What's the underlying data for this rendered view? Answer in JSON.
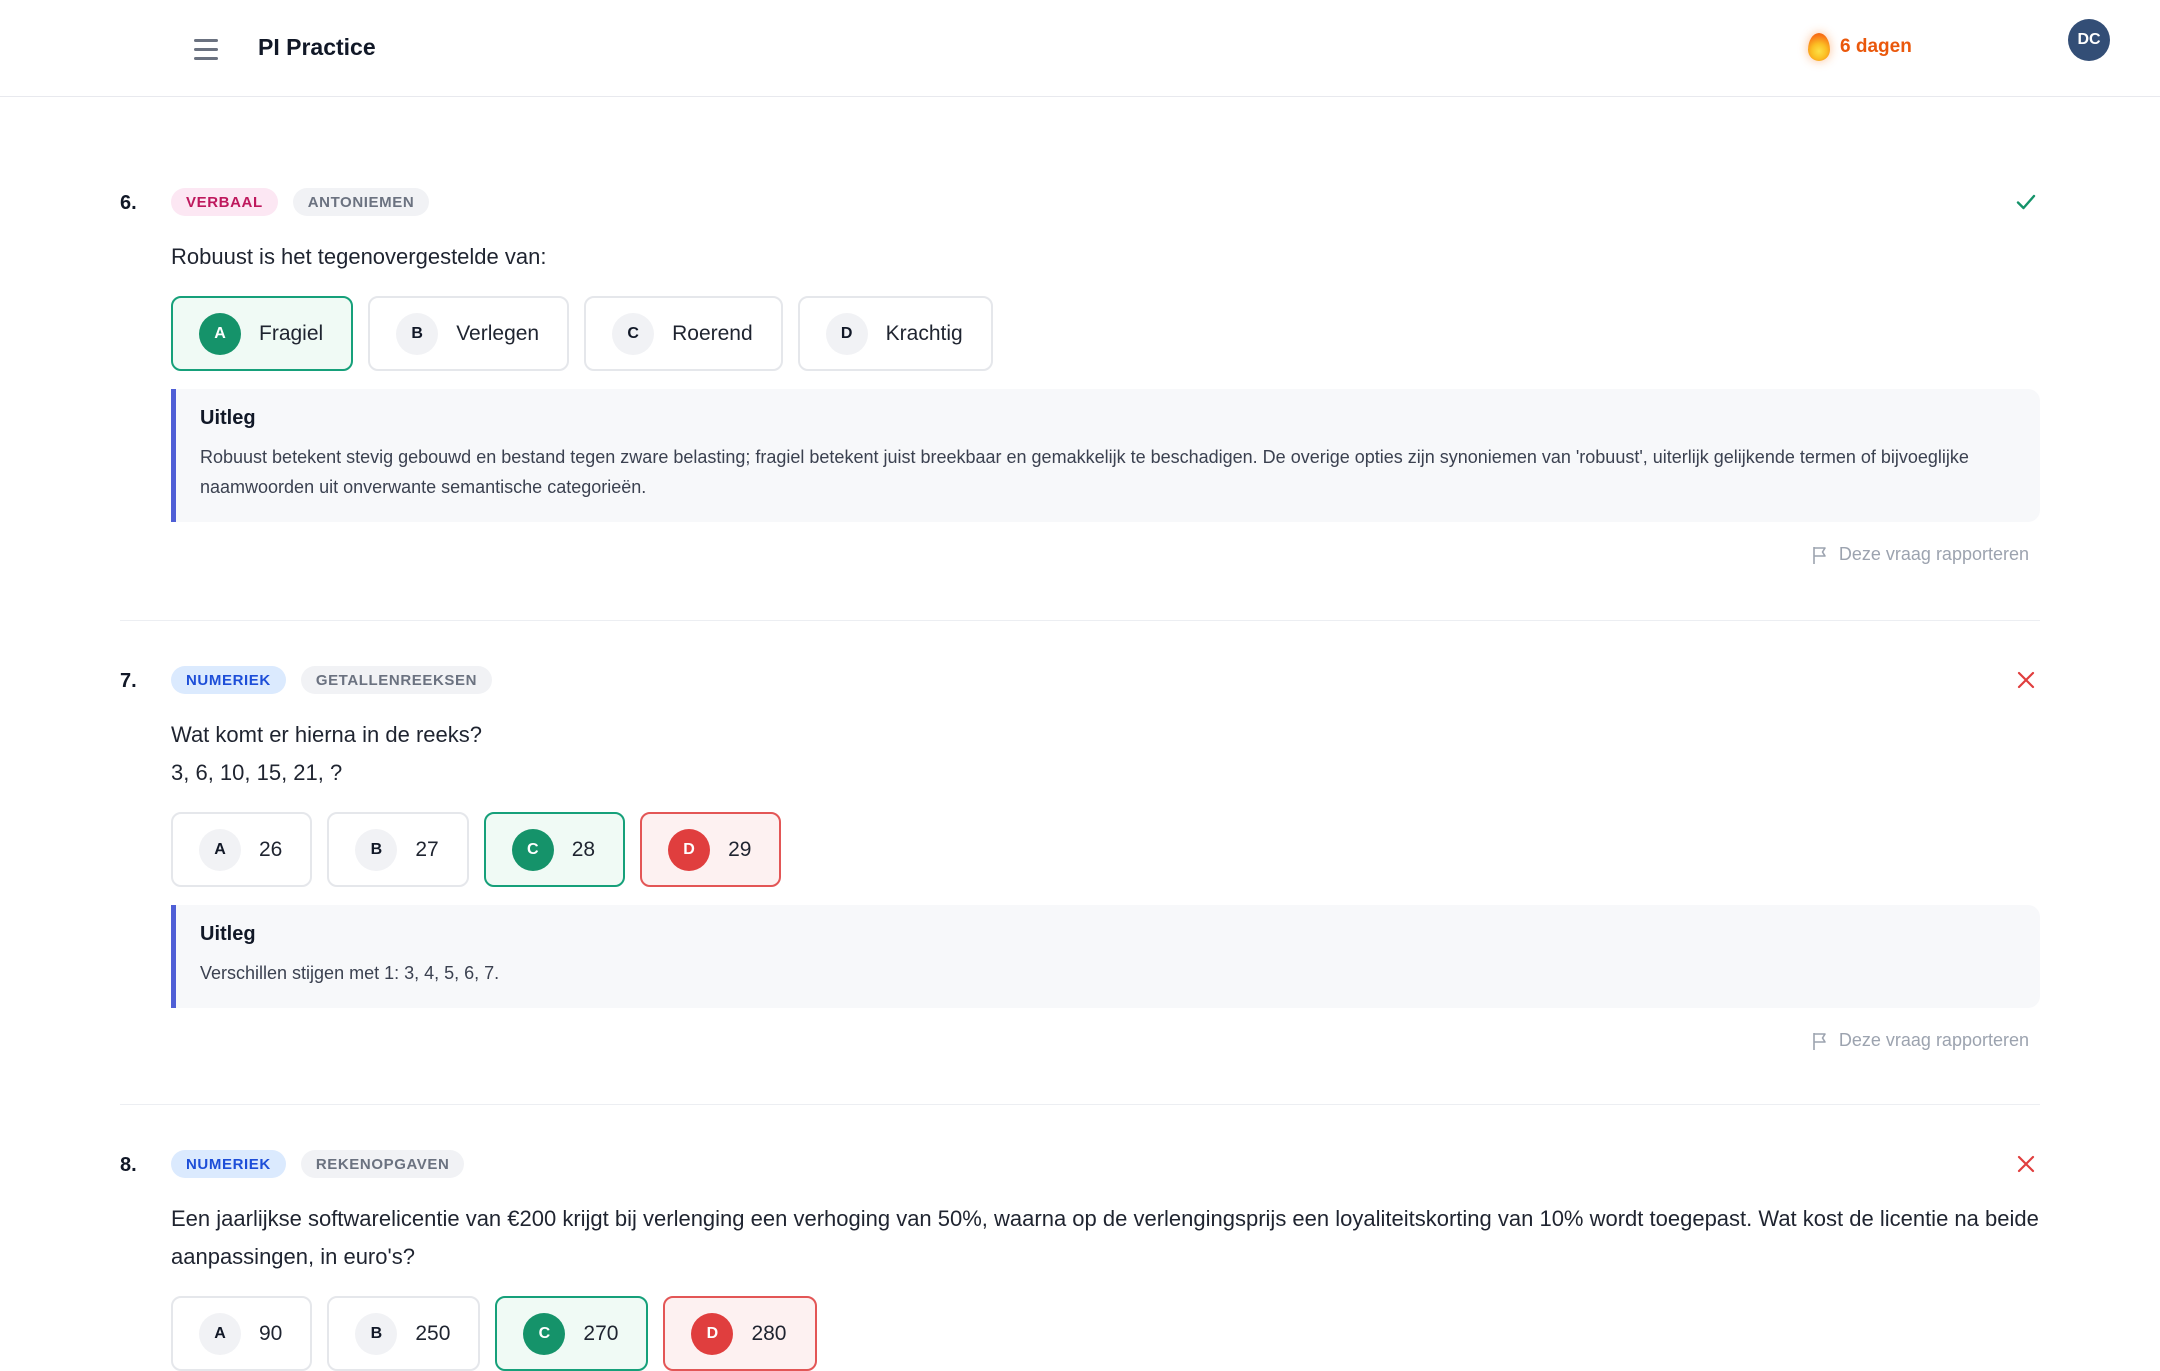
{
  "app": {
    "title": "PI Practice",
    "streak_text": "6 dagen",
    "avatar_initials": "DC"
  },
  "labels": {
    "explanation_title": "Uitleg",
    "report": "Deze vraag rapporteren"
  },
  "colors": {
    "correct": "#15936a",
    "wrong": "#e03e3e",
    "accent_bar": "#4f5fd6",
    "streak": "#ea580c"
  },
  "questions": [
    {
      "number": "6.",
      "category": "VERBAAL",
      "subcategory": "ANTONIEMEN",
      "status": "correct",
      "status_icon": "check-icon",
      "text": "Robuust is het tegenovergestelde van:",
      "options": [
        {
          "letter": "A",
          "value": "Fragiel",
          "state": "correct"
        },
        {
          "letter": "B",
          "value": "Verlegen",
          "state": "neutral"
        },
        {
          "letter": "C",
          "value": "Roerend",
          "state": "neutral"
        },
        {
          "letter": "D",
          "value": "Krachtig",
          "state": "neutral"
        }
      ],
      "explanation": "Robuust betekent stevig gebouwd en bestand tegen zware belasting; fragiel betekent juist breekbaar en gemakkelijk te beschadigen. De overige opties zijn synoniemen van 'robuust', uiterlijk gelijkende termen of bijvoeglijke naamwoorden uit onverwante semantische categorieën."
    },
    {
      "number": "7.",
      "category": "NUMERIEK",
      "subcategory": "GETALLENREEKSEN",
      "status": "wrong",
      "status_icon": "cross-icon",
      "text": "Wat komt er hierna in de reeks?",
      "text_line2": "3, 6, 10, 15, 21, ?",
      "options": [
        {
          "letter": "A",
          "value": "26",
          "state": "neutral"
        },
        {
          "letter": "B",
          "value": "27",
          "state": "neutral"
        },
        {
          "letter": "C",
          "value": "28",
          "state": "correct"
        },
        {
          "letter": "D",
          "value": "29",
          "state": "wrong"
        }
      ],
      "explanation": "Verschillen stijgen met 1: 3, 4, 5, 6, 7."
    },
    {
      "number": "8.",
      "category": "NUMERIEK",
      "subcategory": "REKENOPGAVEN",
      "status": "wrong",
      "status_icon": "cross-icon",
      "text": "Een jaarlijkse softwarelicentie van €200 krijgt bij verlenging een verhoging van 50%, waarna op de verlengingsprijs een loyaliteitskorting van 10% wordt toegepast. Wat kost de licentie na beide aanpassingen, in euro's?",
      "options": [
        {
          "letter": "A",
          "value": "90",
          "state": "neutral"
        },
        {
          "letter": "B",
          "value": "250",
          "state": "neutral"
        },
        {
          "letter": "C",
          "value": "270",
          "state": "correct"
        },
        {
          "letter": "D",
          "value": "280",
          "state": "wrong"
        }
      ]
    }
  ]
}
